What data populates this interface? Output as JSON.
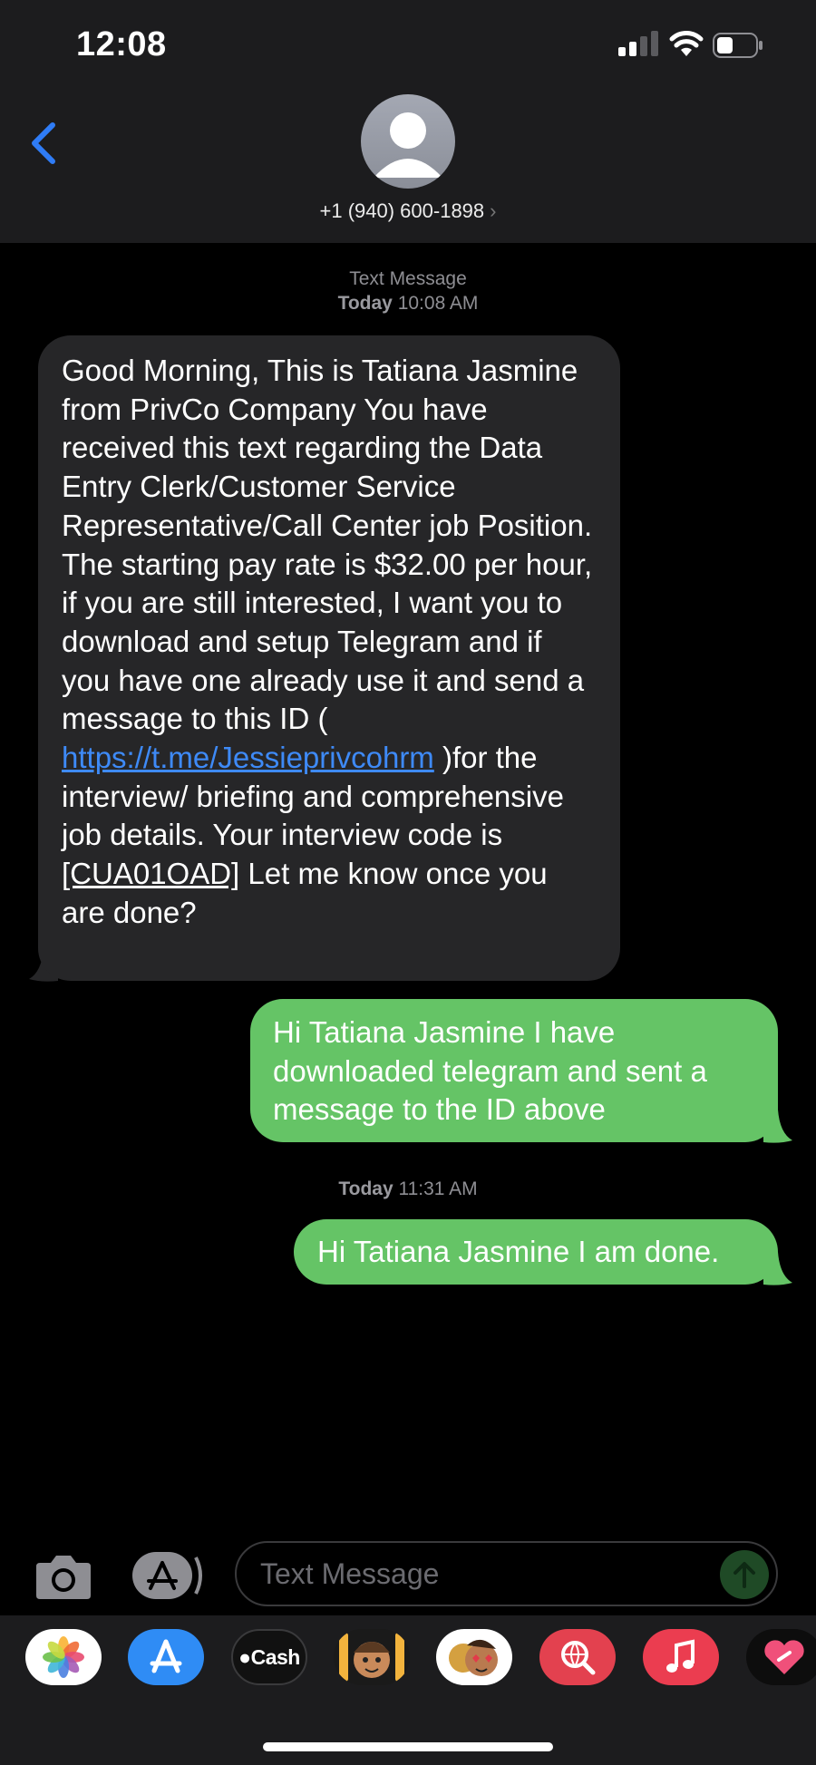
{
  "status_bar": {
    "time": "12:08"
  },
  "header": {
    "contact": "+1 (940) 600-1898",
    "contact_chevron": "›"
  },
  "thread": {
    "stamp1_label": "Text Message",
    "stamp1_time_day": "Today",
    "stamp1_time": "10:08 AM",
    "incoming": {
      "part1": "Good Morning, This is Tatiana Jasmine from PrivCo Company You have received this text regarding the Data Entry Clerk/Customer Service Representative/Call Center job Position. The starting pay rate is $32.00 per hour, if you are still interested, I want you to download and setup Telegram and if you have one already use it and send a message to this ID ( ",
      "link": "https://t.me/Jessieprivcohrm",
      "part2": " )for the interview/ briefing and comprehensive job details. Your interview code is ",
      "code": "[CUA01OAD]",
      "part3": " Let me know once you are done?"
    },
    "outgoing1": "Hi Tatiana Jasmine I have downloaded telegram and sent a message to the ID above",
    "stamp2_day": "Today",
    "stamp2_time": "11:31 AM",
    "outgoing2": "Hi Tatiana Jasmine I am done."
  },
  "input": {
    "placeholder": "Text Message"
  },
  "drawer": {
    "cash_label": "Cash",
    "apps": [
      "photos-icon",
      "app-store-icon",
      "apple-cash-icon",
      "memoji-icon",
      "memoji-stickers-icon",
      "web-search-icon",
      "music-icon",
      "fitness-icon"
    ]
  },
  "colors": {
    "outgoing": "#65c466",
    "incoming": "#262628",
    "link": "#3e8af7",
    "ios_blue": "#2f7cf6"
  }
}
